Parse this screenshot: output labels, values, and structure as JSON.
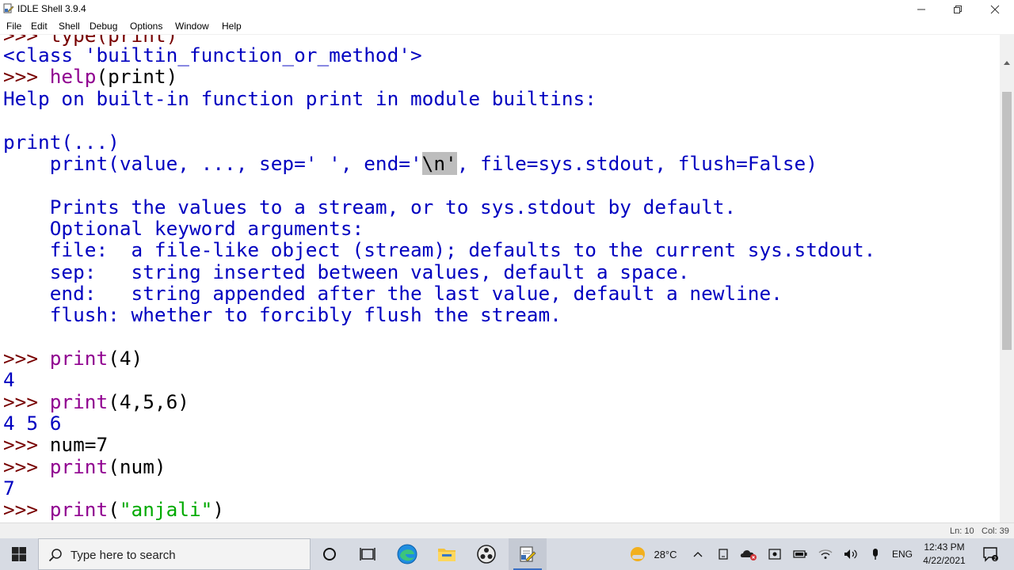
{
  "window": {
    "title": "IDLE Shell 3.9.4"
  },
  "menu": [
    {
      "label": "File"
    },
    {
      "label": "Edit"
    },
    {
      "label": "Shell"
    },
    {
      "label": "Debug"
    },
    {
      "label": "Options"
    },
    {
      "label": "Window"
    },
    {
      "label": "Help"
    }
  ],
  "shell": {
    "partial_top": ">>> type(print)",
    "l1": "<class 'builtin_function_or_method'>",
    "l2_prompt": ">>> ",
    "l2_builtin": "help",
    "l2_rest": "(print)",
    "l3": "Help on built-in function print in module builtins:",
    "l5": "print(...)",
    "l6_a": "    print(value, ..., sep=' ', end='",
    "l6_hl": "\\n'",
    "l6_b": ", file=sys.stdout, flush=False)",
    "l8": "    Prints the values to a stream, or to sys.stdout by default.",
    "l9": "    Optional keyword arguments:",
    "l10": "    file:  a file-like object (stream); defaults to the current sys.stdout.",
    "l11": "    sep:   string inserted between values, default a space.",
    "l12": "    end:   string appended after the last value, default a newline.",
    "l13": "    flush: whether to forcibly flush the stream.",
    "l15_prompt": ">>> ",
    "l15_builtin": "print",
    "l15_rest": "(4)",
    "l16": "4",
    "l17_prompt": ">>> ",
    "l17_builtin": "print",
    "l17_rest": "(4,5,6)",
    "l18": "4 5 6",
    "l19_prompt": ">>> ",
    "l19_code": "num=7",
    "l20_prompt": ">>> ",
    "l20_builtin": "print",
    "l20_rest_a": "(num)",
    "l21": "7",
    "l22_prompt": ">>> ",
    "l22_builtin": "print",
    "l22_open": "(",
    "l22_string": "\"anjali\"",
    "l22_close": ")"
  },
  "status": {
    "ln": "Ln: 10",
    "col": "Col: 39"
  },
  "taskbar": {
    "search_placeholder": "Type here to search",
    "weather": "28°C",
    "language": "ENG",
    "time": "12:43 PM",
    "date": "4/22/2021",
    "icons": [
      "windows-start-icon",
      "cortana-icon",
      "task-view-icon",
      "edge-icon",
      "file-explorer-icon",
      "obs-icon",
      "idle-icon"
    ]
  },
  "colors": {
    "console": "#770000",
    "stdout": "#0000c0",
    "builtin": "#900090",
    "string": "#00aa00",
    "taskbar_bg": "#d7dbe3"
  }
}
